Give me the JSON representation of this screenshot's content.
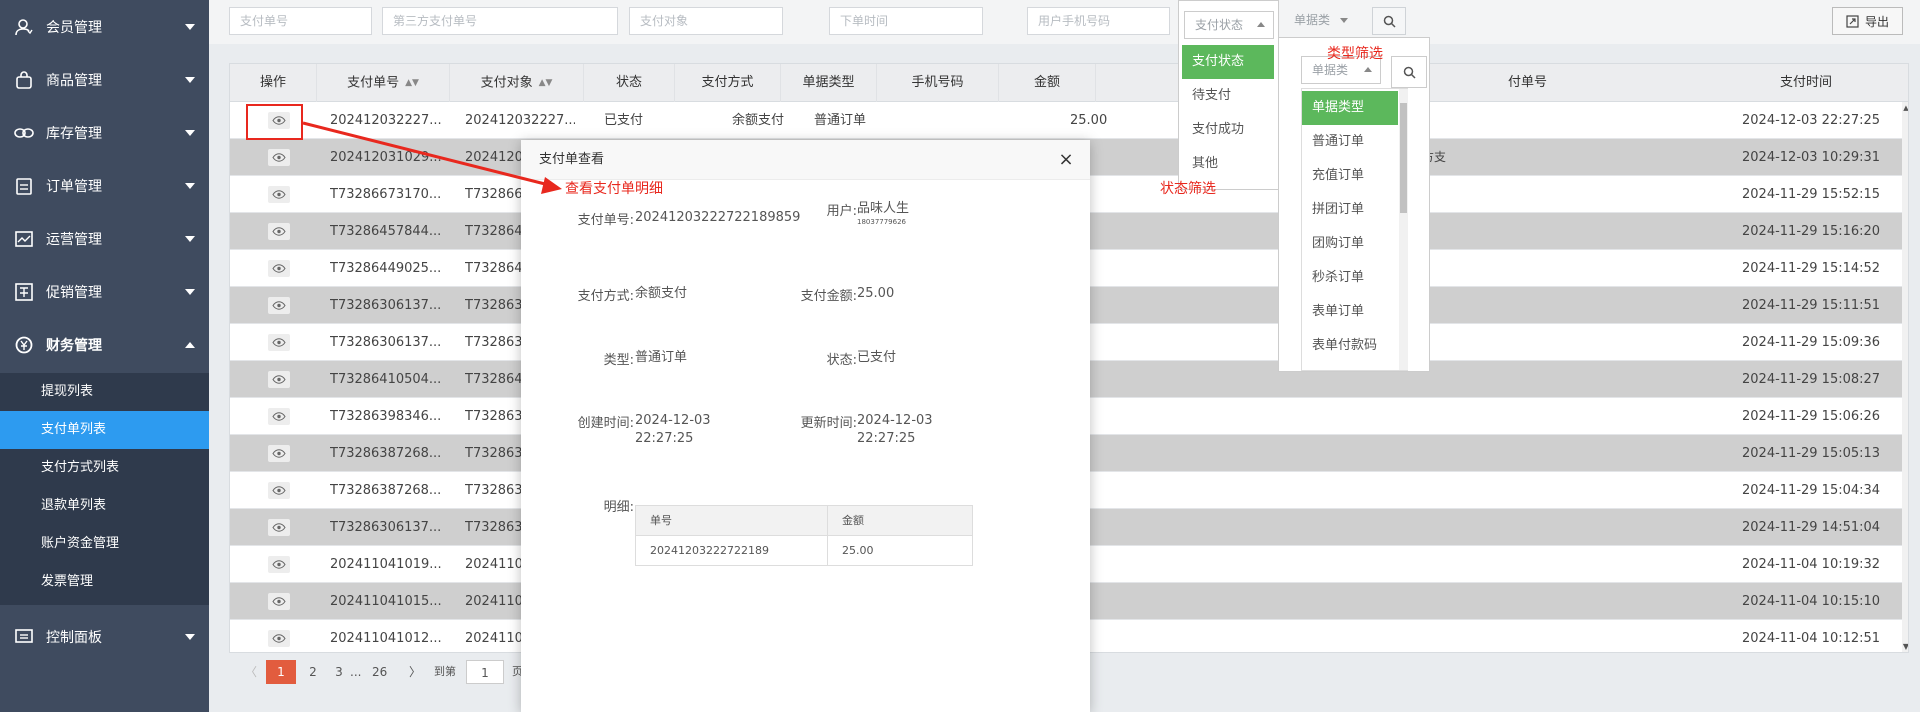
{
  "sidebar": {
    "items": [
      {
        "label": "会员管理",
        "icon": "user-icon"
      },
      {
        "label": "商品管理",
        "icon": "bag-icon"
      },
      {
        "label": "库存管理",
        "icon": "link-icon"
      },
      {
        "label": "订单管理",
        "icon": "clipboard-icon"
      },
      {
        "label": "运营管理",
        "icon": "chart-icon"
      },
      {
        "label": "促销管理",
        "icon": "promo-icon"
      },
      {
        "label": "财务管理",
        "icon": "finance-icon"
      },
      {
        "label": "控制面板",
        "icon": "dashboard-icon"
      }
    ],
    "sub_items": [
      "提现列表",
      "支付单列表",
      "支付方式列表",
      "退款单列表",
      "账户资金管理",
      "发票管理"
    ],
    "active_sub": "支付单列表"
  },
  "filters": {
    "pay_no": "支付单号",
    "third_no": "第三方支付单号",
    "target": "支付对象",
    "order_time": "下单时间",
    "phone": "用户手机号码",
    "status": "支付状态",
    "type": "单据类",
    "export": "导出"
  },
  "table": {
    "headers": [
      "操作",
      "支付单号",
      "支付对象",
      "状态",
      "支付方式",
      "单据类型",
      "手机号码",
      "金额",
      "付单号",
      "支付时间"
    ],
    "rows": [
      {
        "no": "202412032227...",
        "target": "202412032227...",
        "status": "已支付",
        "method": "余额支付",
        "type": "普通订单",
        "amount": "25.00",
        "time": "2024-12-03 22:27:25"
      },
      {
        "no": "202412031029...",
        "target": "2024120",
        "time": "2024-12-03 10:29:31"
      },
      {
        "no": "T73286673170...",
        "target": "T73286673",
        "time": "2024-11-29 15:52:15"
      },
      {
        "no": "T73286457844...",
        "target": "T73286457",
        "time": "2024-11-29 15:16:20"
      },
      {
        "no": "T73286449025...",
        "target": "T73286449",
        "time": "2024-11-29 15:14:52"
      },
      {
        "no": "T73286306137...",
        "target": "T73286306",
        "time": "2024-11-29 15:11:51"
      },
      {
        "no": "T73286306137...",
        "target": "T73286306",
        "time": "2024-11-29 15:09:36"
      },
      {
        "no": "T73286410504...",
        "target": "T73286410",
        "time": "2024-11-29 15:08:27"
      },
      {
        "no": "T73286398346...",
        "target": "T73286398",
        "time": "2024-11-29 15:06:26"
      },
      {
        "no": "T73286387268...",
        "target": "T73286387",
        "time": "2024-11-29 15:05:13"
      },
      {
        "no": "T73286387268...",
        "target": "T73286387",
        "time": "2024-11-29 15:04:34"
      },
      {
        "no": "T73286306137...",
        "target": "T73286306",
        "time": "2024-11-29 14:51:04"
      },
      {
        "no": "202411041019...",
        "target": "2024110",
        "time": "2024-11-04 10:19:32"
      },
      {
        "no": "202411041015...",
        "target": "2024110",
        "time": "2024-11-04 10:15:10"
      },
      {
        "no": "202411041012...",
        "target": "2024110",
        "time": "2024-11-04 10:12:51"
      }
    ],
    "row1_partial": "方支"
  },
  "pager": {
    "pages": [
      "1",
      "2",
      "3",
      "...",
      "26"
    ],
    "goto_label": "到第",
    "goto_value": "1",
    "page_suffix": "页"
  },
  "modal": {
    "title": "支付单查看",
    "close": "×",
    "labels": {
      "pay_no": "支付单号:",
      "user": "用户:",
      "method": "支付方式:",
      "amount": "支付金额:",
      "type": "类型:",
      "status": "状态:",
      "created": "创建时间:",
      "updated": "更新时间:",
      "detail": "明细:"
    },
    "values": {
      "pay_no": "202412032227221898​59",
      "user_name": "品味人生",
      "user_phone": "18037779626",
      "method": "余额支付",
      "amount": "25.00",
      "type": "普通订单",
      "status": "已支付",
      "created_date": "2024-12-03",
      "created_time": "22:27:25",
      "updated_date": "2024-12-03",
      "updated_time": "22:27:25"
    },
    "detail_table": {
      "headers": [
        "单号",
        "金额"
      ],
      "row": [
        "20241203222722189",
        "25.00"
      ]
    }
  },
  "status_dropdown": {
    "placeholder": "支付状态",
    "options": [
      "支付状态",
      "待支付",
      "支付成功",
      "其他"
    ],
    "selected": "支付状态"
  },
  "type_dropdown": {
    "placeholder": "单据类",
    "options": [
      "单据类型",
      "普通订单",
      "充值订单",
      "拼团订单",
      "团购订单",
      "秒杀订单",
      "表单订单",
      "表单付款码"
    ],
    "selected": "单据类型"
  },
  "annotations": {
    "view_detail": "查看支付单明细",
    "status_filter": "状态筛选",
    "type_filter": "类型筛选"
  },
  "colors": {
    "sidebar": "#3f4b5f",
    "active": "#2d9bf0",
    "accent_red": "#e8281e",
    "select_green": "#5cb85c",
    "pager_active": "#e25c3e"
  }
}
